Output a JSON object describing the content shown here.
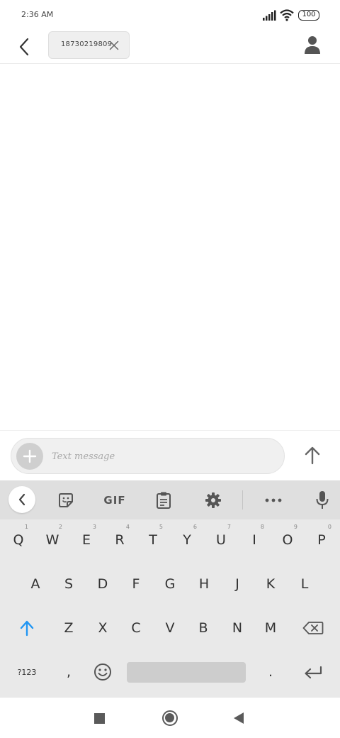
{
  "status_bar": {
    "time": "2:36 AM",
    "battery": "100",
    "icons": [
      "signal-icon",
      "wifi-icon",
      "battery-icon"
    ]
  },
  "header": {
    "back_icon": "chevron-left-icon",
    "recipient": "18730219809",
    "remove_icon": "close-icon",
    "contact_icon": "person-icon"
  },
  "compose": {
    "placeholder": "Text message",
    "value": "",
    "attach_icon": "plus-icon",
    "send_icon": "arrow-up-icon"
  },
  "keyboard": {
    "toolbar": {
      "collapse_icon": "chevron-left-icon",
      "sticker_icon": "sticker-icon",
      "gif_label": "GIF",
      "clipboard_icon": "clipboard-icon",
      "settings_icon": "gear-icon",
      "more_icon": "more-icon",
      "mic_icon": "microphone-icon"
    },
    "row1": [
      {
        "label": "Q",
        "hint": "1"
      },
      {
        "label": "W",
        "hint": "2"
      },
      {
        "label": "E",
        "hint": "3"
      },
      {
        "label": "R",
        "hint": "4"
      },
      {
        "label": "T",
        "hint": "5"
      },
      {
        "label": "Y",
        "hint": "6"
      },
      {
        "label": "U",
        "hint": "7"
      },
      {
        "label": "I",
        "hint": "8"
      },
      {
        "label": "O",
        "hint": "9"
      },
      {
        "label": "P",
        "hint": "0"
      }
    ],
    "row2": [
      "A",
      "S",
      "D",
      "F",
      "G",
      "H",
      "J",
      "K",
      "L"
    ],
    "row3": [
      "Z",
      "X",
      "C",
      "V",
      "B",
      "N",
      "M"
    ],
    "symbols_label": "?123",
    "comma_label": ",",
    "period_label": ".",
    "shift_icon": "shift-icon",
    "backspace_icon": "backspace-icon",
    "emoji_icon": "emoji-icon",
    "enter_icon": "enter-icon",
    "accent_color": "#2196F3"
  },
  "nav_bar": {
    "icons": [
      "recents-icon",
      "home-icon",
      "back-icon"
    ]
  }
}
